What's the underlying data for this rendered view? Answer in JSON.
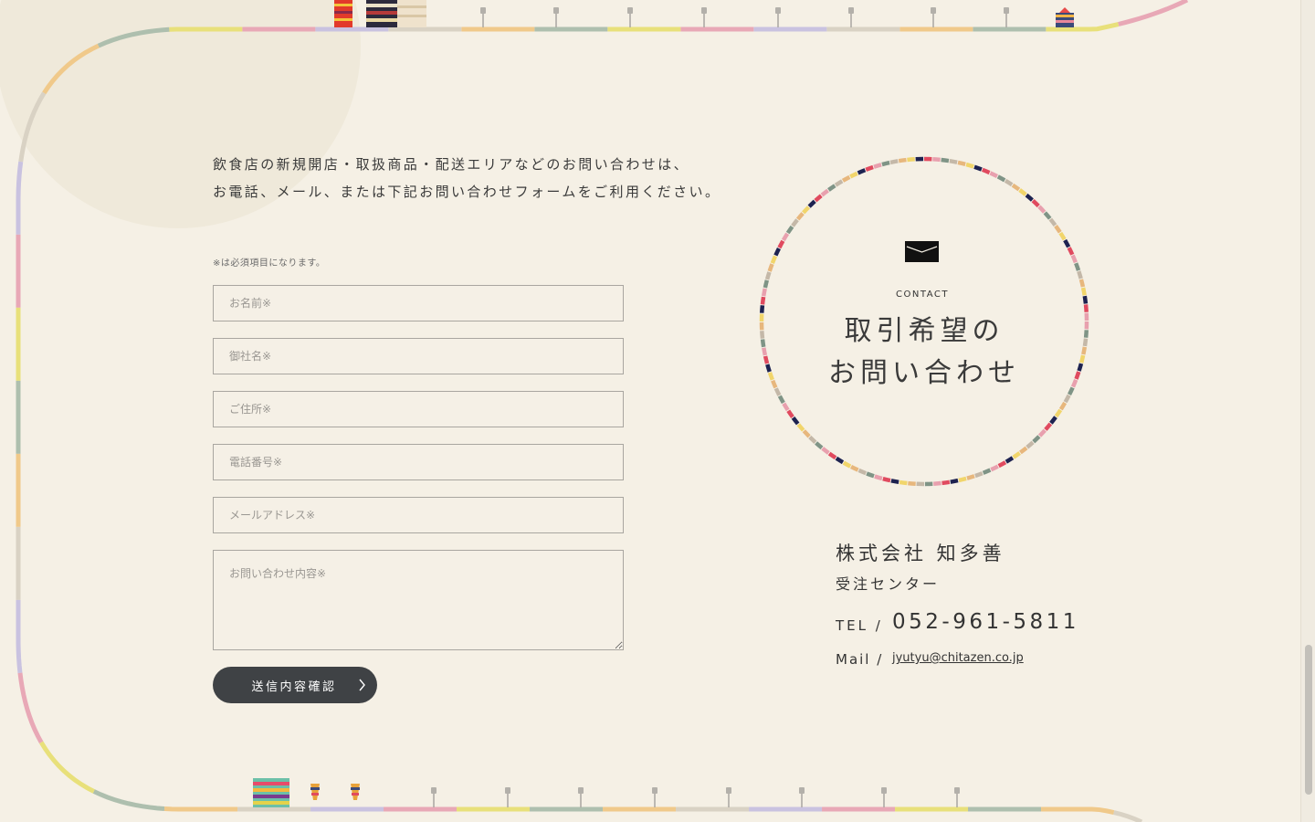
{
  "intro": {
    "line1": "飲食店の新規開店・取扱商品・配送エリアなどのお問い合わせは、",
    "line2": "お電話、メール、または下記お問い合わせフォームをご利用ください。"
  },
  "form": {
    "required_note": "※は必須項目になります。",
    "name_placeholder": "お名前※",
    "company_placeholder": "御社名※",
    "address_placeholder": "ご住所※",
    "phone_placeholder": "電話番号※",
    "email_placeholder": "メールアドレス※",
    "message_placeholder": "お問い合わせ内容※",
    "submit_label": "送信内容確認"
  },
  "contact": {
    "label": "CONTACT",
    "title_line1": "取引希望の",
    "title_line2": "お問い合わせ",
    "company": "株式会社 知多善",
    "department": "受注センター",
    "tel_prefix": "TEL /",
    "tel": "052-961-5811",
    "mail_prefix": "Mail /",
    "email": "jyutyu@chitazen.co.jp"
  },
  "icons": {
    "mail": "envelope-icon",
    "submit_arrow": "chevron-right-icon"
  },
  "colors": {
    "background": "#f5f0e5",
    "button": "#3f4245",
    "ring_colors": [
      "#e8a0ae",
      "#1d2250",
      "#e7b77d",
      "#7f9486",
      "#e04a5f",
      "#f1d56b",
      "#c4b8a8"
    ],
    "track_colors": [
      "#e8a8b6",
      "#e8e07a",
      "#aebfae",
      "#f0c98a",
      "#d9d2c4",
      "#c9c2e0"
    ]
  }
}
